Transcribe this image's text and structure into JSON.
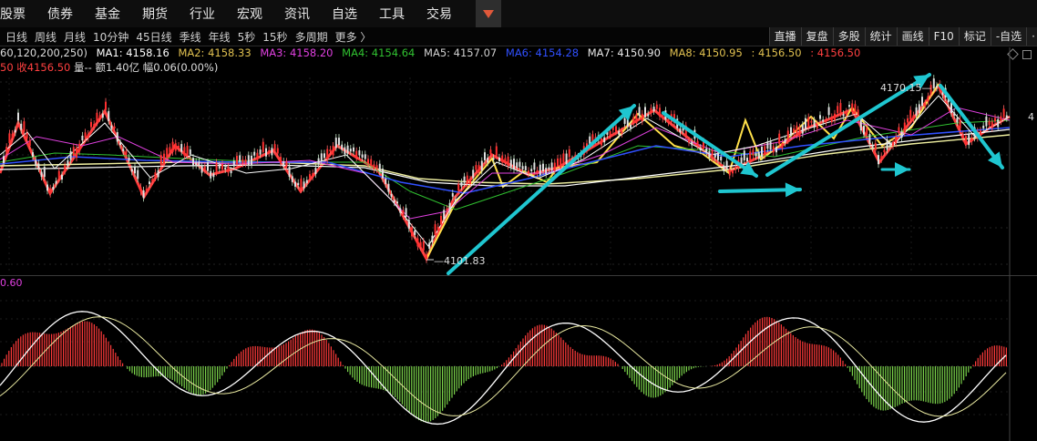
{
  "nav": {
    "items": [
      "股票",
      "债券",
      "基金",
      "期货",
      "行业",
      "宏观",
      "资讯",
      "自选",
      "工具",
      "交易"
    ]
  },
  "period": {
    "items": [
      "日线",
      "周线",
      "月线",
      "10分钟",
      "45日线",
      "季线",
      "年线",
      "5秒",
      "15秒",
      "多周期",
      "更多 〉"
    ]
  },
  "tools": {
    "items": [
      "直播",
      "复盘",
      "多股",
      "统计",
      "画线",
      "F10",
      "标记",
      "-自选",
      "·"
    ]
  },
  "ma": {
    "params": "60,120,200,250)",
    "ma1": "MA1: 4158.16",
    "ma2": "MA2: 4158.33",
    "ma3": "MA3: 4158.20",
    "ma4": "MA4: 4154.64",
    "ma5": "MA5: 4157.07",
    "ma6": "MA6: 4154.28",
    "ma7": "MA7: 4150.90",
    "ma8": "MA8: 4150.95",
    "close_label": ": 4156.50",
    "close_value": ": 4156.50"
  },
  "info": {
    "close_prefix": "50 收4156.50",
    "volume_label": "量-- 额1.40亿 幅0.06(0.00%)"
  },
  "chart_labels": {
    "low_label": "4101.83",
    "high_label": "4170.15",
    "right_value": "4",
    "macd_label": "0.60"
  },
  "colors": {
    "up": "#ff3a3a",
    "down": "#7ad24a",
    "cyan": "#1fc6d0",
    "yellow": "#ffe04a",
    "ma1": "#ffffff",
    "ma2": "#e0c050",
    "ma3": "#e040e0",
    "ma4": "#30c030",
    "ma5": "#d0d0d0",
    "ma6": "#3050ff",
    "ma7": "#e8e8e8",
    "ma8": "#e0c050",
    "close_color": "#ff4040"
  }
}
